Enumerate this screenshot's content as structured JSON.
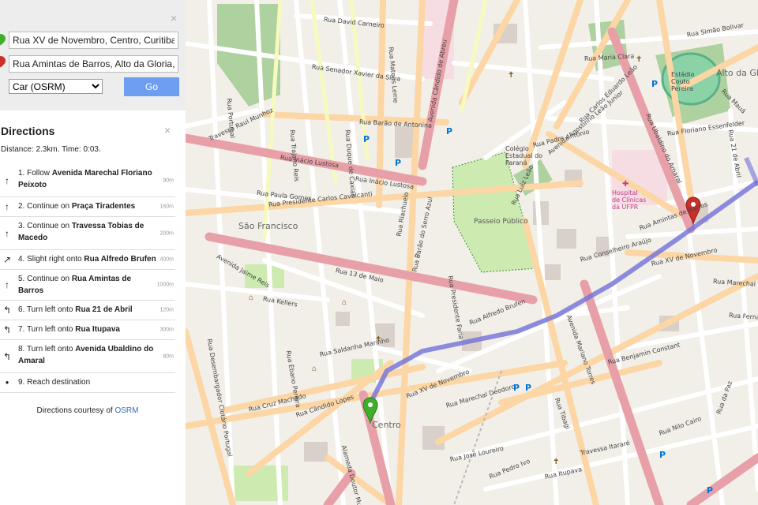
{
  "search": {
    "close_glyph": "×",
    "from_value": "Rua XV de Novembro, Centro, Curitiba, Paraná",
    "to_value": "Rua Amintas de Barros, Alto da Gloria, Curitiba",
    "router_selected": "Car (OSRM)",
    "go_label": "Go",
    "from_pin_color": "#3fae2a",
    "to_pin_color": "#c9302c",
    "go_color": "#6d9ef0"
  },
  "directions": {
    "title": "Directions",
    "close_glyph": "×",
    "summary": "Distance: 2.3km. Time: 0:03.",
    "steps": [
      {
        "icon": "arrow-up-icon",
        "glyph": "↑",
        "pre": "1. Follow ",
        "street": "Avenida Marechal Floriano Peixoto",
        "dist": "90m"
      },
      {
        "icon": "arrow-up-icon",
        "glyph": "↑",
        "pre": "2. Continue on ",
        "street": "Praça Tiradentes",
        "dist": "160m"
      },
      {
        "icon": "arrow-up-icon",
        "glyph": "↑",
        "pre": "3. Continue on ",
        "street": "Travessa Tobias de Macedo",
        "dist": "200m"
      },
      {
        "icon": "slight-right-icon",
        "glyph": "↗",
        "pre": "4. Slight right onto ",
        "street": "Rua Alfredo Brufen",
        "dist": "400m"
      },
      {
        "icon": "arrow-up-icon",
        "glyph": "↑",
        "pre": "5. Continue on ",
        "street": "Rua Amintas de Barros",
        "dist": "1000m"
      },
      {
        "icon": "turn-left-icon",
        "glyph": "↰",
        "pre": "6. Turn left onto ",
        "street": "Rua 21 de Abril",
        "dist": "120m"
      },
      {
        "icon": "turn-left-icon",
        "glyph": "↰",
        "pre": "7. Turn left onto ",
        "street": "Rua Itupava",
        "dist": "300m"
      },
      {
        "icon": "turn-left-icon",
        "glyph": "↰",
        "pre": "8. Turn left onto ",
        "street": "Avenida Ubaldino do Amaral",
        "dist": "80m"
      },
      {
        "icon": "destination-dot-icon",
        "glyph": "●",
        "pre": "9. Reach destination",
        "street": "",
        "dist": ""
      }
    ],
    "credit_prefix": "Directions courtesy of ",
    "credit_link": "OSRM"
  },
  "map": {
    "route_color": "#7070d8",
    "start_marker_color": "#3fae2a",
    "end_marker_color": "#c9302c",
    "place_labels": [
      "Passeio Público",
      "Colégio Estadual do Paraná",
      "São Francisco",
      "Centro",
      "Alto da Glória",
      "Estádio Couto Pereira",
      "Hospital de Clínicas da UFPR"
    ],
    "street_labels": [
      "Rua David Carneiro",
      "Rua Inácio Lustosa",
      "Rua Presidente Carlos Cavalcanti",
      "Rua 13 de Maio",
      "Rua Alfredo Brufen",
      "Rua Amintas de Barros",
      "Rua XV de Novembro",
      "Rua Marechal Deodoro",
      "Rua Cruz Machado",
      "Rua Cândido Lopes",
      "Rua Saldanha Marinho",
      "Rua Kellers",
      "Avenida Jaime Reis",
      "Rua Paula Gomes",
      "Travessa Raul Munhoz",
      "Rua Barão de Antonina",
      "Rua Senador Xavier da Silva",
      "Rua Maria Clara",
      "Rua Simão Bolivar",
      "Rua Mauá",
      "Rua 21 de Abril",
      "Rua Floriano Essenfelder",
      "Rua Conselheiro Araújo",
      "Rua Marechal De",
      "Rua Fernando A",
      "Rua Nilo Cairo",
      "Rua da Paz",
      "Travessa Itararé",
      "Rua Itupava",
      "Rua José Loureiro",
      "Rua Pedro Ivo",
      "Rua Benjamin Constant",
      "Rua Ubaldino do Amaral",
      "Avenida Mariano Torres",
      "Rua Tibagi",
      "Rua Desembargador Clotário Portugal",
      "Rua Riachuelo",
      "Rua Barão do Serro Azul",
      "Rua Presidente Faria",
      "Avenida Cândido de Abreu",
      "Rua Mateus Leme",
      "Rua Duque de Caxias",
      "Rua Trajano Reis",
      "Rua Portugal",
      "Rua Carlos Cavalcanti",
      "Rua Ébano Pereira",
      "Rua Treze de Maio",
      "Alameda Doutor Muricy",
      "Rua Luiz Leão",
      "Avenida Agostinho Leão Junior",
      "Rua Padre Antônio",
      "Rua Carlos Eduardo Leão"
    ],
    "parking_symbol": "P"
  }
}
